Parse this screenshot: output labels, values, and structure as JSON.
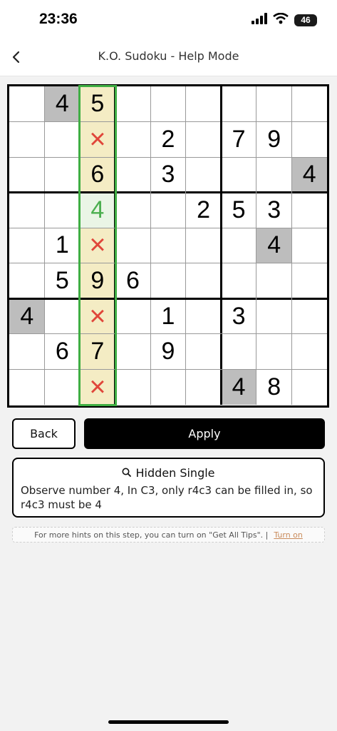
{
  "status": {
    "time": "23:36",
    "battery": "46"
  },
  "nav": {
    "title": "K.O. Sudoku - Help Mode"
  },
  "board": {
    "cells": [
      {
        "r": 0,
        "c": 1,
        "v": "4",
        "kind": "given"
      },
      {
        "r": 0,
        "c": 2,
        "v": "5",
        "kind": "hl"
      },
      {
        "r": 1,
        "c": 2,
        "v": "×",
        "kind": "hl-x"
      },
      {
        "r": 1,
        "c": 4,
        "v": "2",
        "kind": ""
      },
      {
        "r": 1,
        "c": 6,
        "v": "7",
        "kind": ""
      },
      {
        "r": 1,
        "c": 7,
        "v": "9",
        "kind": ""
      },
      {
        "r": 2,
        "c": 2,
        "v": "6",
        "kind": "hl"
      },
      {
        "r": 2,
        "c": 4,
        "v": "3",
        "kind": ""
      },
      {
        "r": 2,
        "c": 8,
        "v": "4",
        "kind": "given"
      },
      {
        "r": 3,
        "c": 2,
        "v": "4",
        "kind": "hl-green"
      },
      {
        "r": 3,
        "c": 5,
        "v": "2",
        "kind": ""
      },
      {
        "r": 3,
        "c": 6,
        "v": "5",
        "kind": ""
      },
      {
        "r": 3,
        "c": 7,
        "v": "3",
        "kind": ""
      },
      {
        "r": 4,
        "c": 1,
        "v": "1",
        "kind": ""
      },
      {
        "r": 4,
        "c": 2,
        "v": "×",
        "kind": "hl-x"
      },
      {
        "r": 4,
        "c": 7,
        "v": "4",
        "kind": "given"
      },
      {
        "r": 5,
        "c": 1,
        "v": "5",
        "kind": ""
      },
      {
        "r": 5,
        "c": 2,
        "v": "9",
        "kind": "hl"
      },
      {
        "r": 5,
        "c": 3,
        "v": "6",
        "kind": ""
      },
      {
        "r": 6,
        "c": 0,
        "v": "4",
        "kind": "given"
      },
      {
        "r": 6,
        "c": 2,
        "v": "×",
        "kind": "hl-x"
      },
      {
        "r": 6,
        "c": 4,
        "v": "1",
        "kind": ""
      },
      {
        "r": 6,
        "c": 6,
        "v": "3",
        "kind": ""
      },
      {
        "r": 7,
        "c": 1,
        "v": "6",
        "kind": ""
      },
      {
        "r": 7,
        "c": 2,
        "v": "7",
        "kind": "hl"
      },
      {
        "r": 7,
        "c": 4,
        "v": "9",
        "kind": ""
      },
      {
        "r": 8,
        "c": 2,
        "v": "×",
        "kind": "hl-x"
      },
      {
        "r": 8,
        "c": 6,
        "v": "4",
        "kind": "given"
      },
      {
        "r": 8,
        "c": 7,
        "v": "8",
        "kind": ""
      }
    ],
    "colors": {
      "highlight": "#f4ecc4",
      "given": "#bdbdbd",
      "target": "#4caf50",
      "cross": "#e0463a",
      "outline": "#3fae43"
    }
  },
  "actions": {
    "back_label": "Back",
    "apply_label": "Apply"
  },
  "hint": {
    "title": "Hidden Single",
    "text": "Observe number 4, In C3, only r4c3 can be filled in, so r4c3 must be 4"
  },
  "tips": {
    "text": "For more hints on this step, you can turn on \"Get All Tips\". |",
    "link": "Turn on"
  }
}
